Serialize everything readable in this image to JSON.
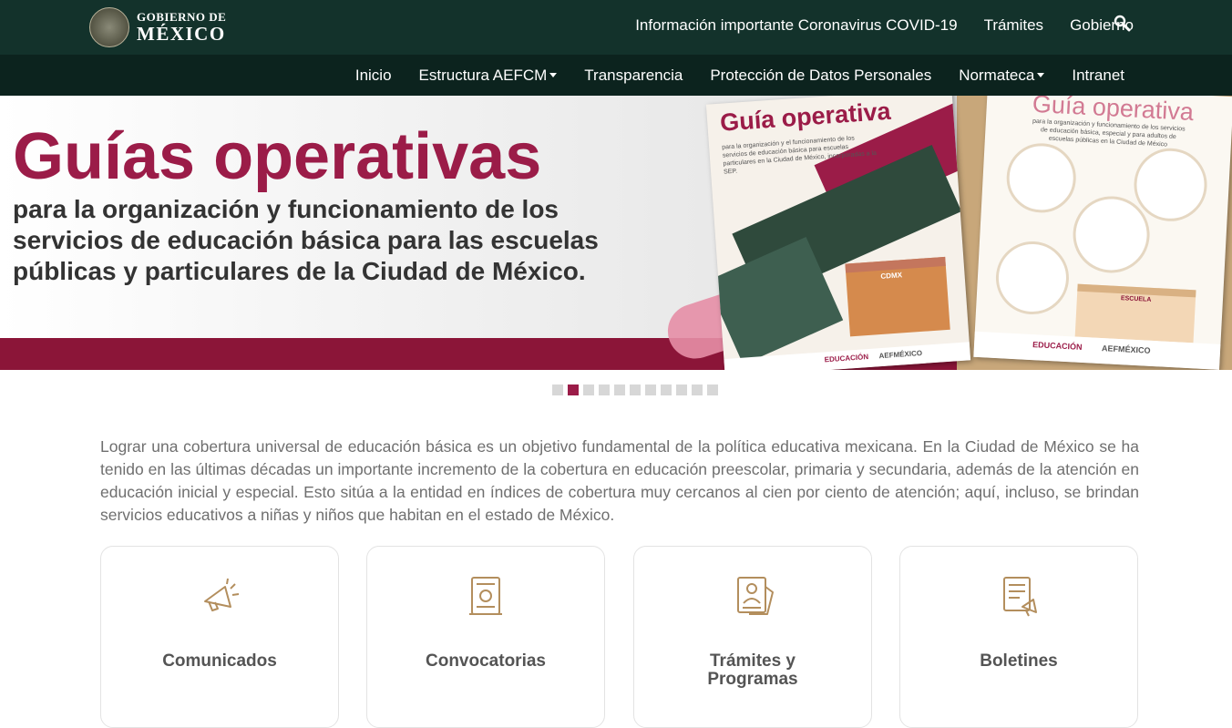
{
  "header": {
    "logo": {
      "line1": "GOBIERNO DE",
      "line2": "MÉXICO"
    },
    "nav": [
      {
        "label": "Información importante Coronavirus COVID-19"
      },
      {
        "label": "Trámites"
      },
      {
        "label": "Gobierno"
      }
    ],
    "search_icon": "search-icon"
  },
  "subnav": {
    "items": [
      {
        "label": "Inicio",
        "dropdown": false
      },
      {
        "label": "Estructura AEFCM",
        "dropdown": true
      },
      {
        "label": "Transparencia",
        "dropdown": false
      },
      {
        "label": "Protección de Datos Personales",
        "dropdown": false
      },
      {
        "label": "Normateca",
        "dropdown": true
      },
      {
        "label": "Intranet",
        "dropdown": false
      }
    ]
  },
  "banner": {
    "title": "Guías operativas",
    "subtitle": "para la organización y funcionamiento de los servicios de educación básica para las escuelas públicas y particulares de la Ciudad de México.",
    "guide1": {
      "title": "Guía operativa",
      "text": "para la organización y el funcionamiento de los servicios de educación básica para escuelas particulares en la Ciudad de México, incorporadas a la SEP.",
      "sign": "CDMX",
      "footer_left": "EDUCACIÓN",
      "footer_right": "AEFMÉXICO"
    },
    "guide2": {
      "title": "Guía operativa",
      "text": "para la organización y funcionamiento de los servicios de educación básica, especial y para adultos de escuelas públicas en la Ciudad de México",
      "sign": "ESCUELA",
      "footer_left": "EDUCACIÓN",
      "footer_right": "AEFMÉXICO"
    },
    "colors": {
      "brand": "#9b1c48",
      "band": "#8b1538",
      "header": "#13322b",
      "subnav": "#0c231e"
    }
  },
  "carousel": {
    "total": 11,
    "active": 2
  },
  "intro": "Lograr una cobertura universal de educación básica es un objetivo fundamental de la política educativa mexicana. En la Ciudad de México se ha tenido en las últimas décadas un importante incremento de la cobertura en educación preescolar, primaria y secundaria, además de la atención en educación inicial y especial. Esto sitúa a la entidad en índices de cobertura muy cercanos al cien por ciento de atención; aquí, incluso, se brindan servicios educativos a niñas y niños que habitan en el estado de México.",
  "cards": [
    {
      "label": "Comunicados",
      "icon": "megaphone-icon"
    },
    {
      "label": "Convocatorias",
      "icon": "certificate-icon"
    },
    {
      "label": "Trámites y Programas",
      "icon": "id-card-icon"
    },
    {
      "label": "Boletines",
      "icon": "bulletin-icon"
    }
  ]
}
